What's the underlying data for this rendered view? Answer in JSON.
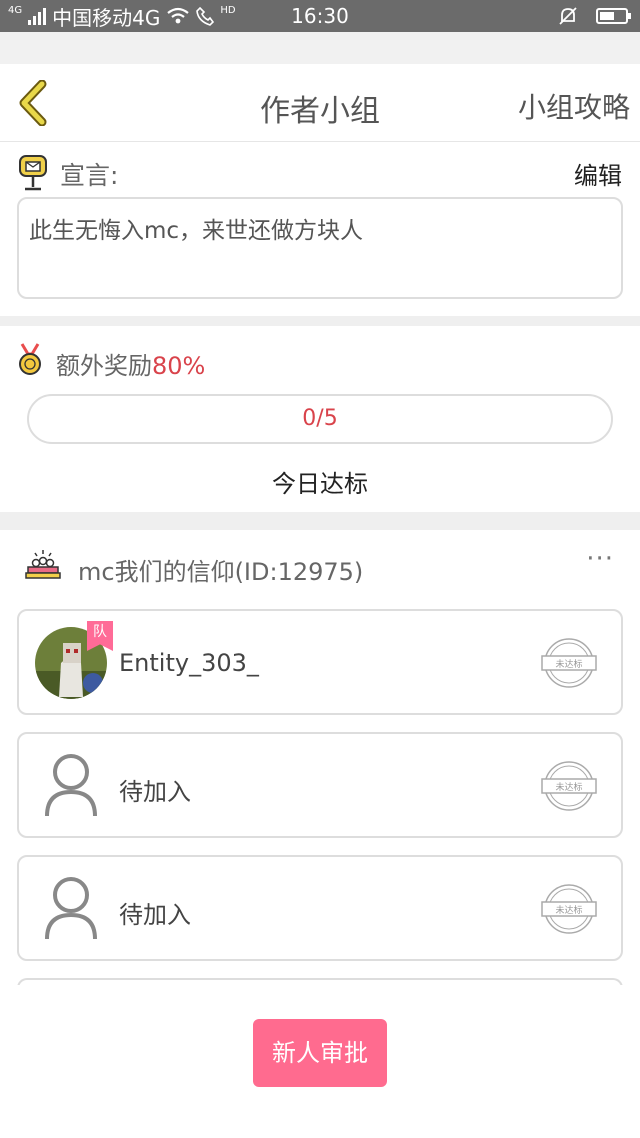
{
  "status_bar": {
    "network_small": "4G",
    "carrier": "中国移动4G",
    "hd": "HD",
    "time": "16:30"
  },
  "header": {
    "title": "作者小组",
    "right_link": "小组攻略"
  },
  "declaration": {
    "label": "宣言:",
    "edit": "编辑",
    "text": "此生无悔入mc，来世还做方块人"
  },
  "bonus": {
    "label": "额外奖励",
    "percent": "80%",
    "progress_text": "0/5",
    "progress_fraction": 0,
    "today_label": "今日达标"
  },
  "group": {
    "name": "mc我们的信仰(ID:12975)",
    "more": "···",
    "members": [
      {
        "name": "Entity_303_",
        "badge": "队",
        "stamp": "未达标"
      },
      {
        "name": "待加入",
        "stamp": "未达标"
      },
      {
        "name": "待加入",
        "stamp": "未达标"
      }
    ]
  },
  "approve_button": "新人审批",
  "colors": {
    "accent_red": "#d9434b",
    "pink_button": "#ff6b8f",
    "back_arrow": "#e8d84a"
  }
}
